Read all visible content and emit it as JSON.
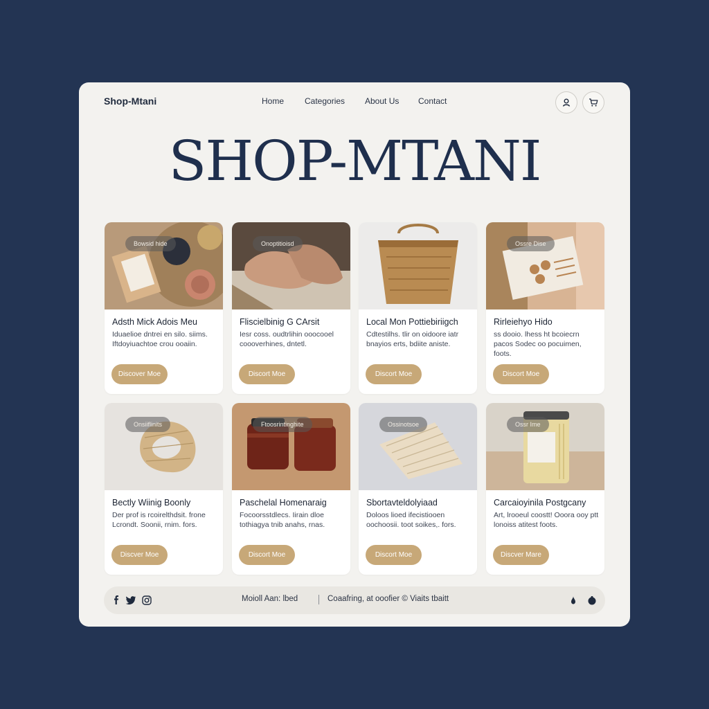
{
  "header": {
    "brand": "Shop-Mtani",
    "nav": [
      "Home",
      "Categories",
      "About Us",
      "Contact"
    ]
  },
  "hero": {
    "title": "SHOP-MTANI"
  },
  "products": [
    {
      "tag": "Bowsid hide",
      "title": "Adsth Mick Adois Meu",
      "desc": "Iduaelioe dntrei en silo. siims. Iftdoyiuachtoe crou ooaiin.",
      "button": "Discover Moe"
    },
    {
      "tag": "Onoptitioisd",
      "title": "Fliscielbinig G CArsit",
      "desc": "Iesr coss. oudtrlihin ooocooel coooverhines, dntetl.",
      "button": "Discort Moe"
    },
    {
      "tag": "",
      "title": "Local Mon Pottiebiriigch",
      "desc": "Cdtestilhs. tlir on oidoore iatr bnayios erts, bdiite aniste.",
      "button": "Discort Moe"
    },
    {
      "tag": "Ossre Dise",
      "title": "Rirleiehyo Hido",
      "desc": "ss dooio. lhess ht bcoiecrn pacos Sodec oo pocuimen, foots.",
      "button": "Discort Moe"
    },
    {
      "tag": "Onsiiflinits",
      "title": "Bectly Wiinig Boonly",
      "desc": "Der prof is rcoirelthdsit. frone Lcrondt. Soonii, rnim. fors.",
      "button": "Discver Moe"
    },
    {
      "tag": "Ftoosrintinghite",
      "title": "Paschelal Homenaraig",
      "desc": "Focoorsstdlecs. Iirain dloe tothiagya tnib anahs, rnas.",
      "button": "Discort Moe"
    },
    {
      "tag": "Ossinotsoe",
      "title": "Sbortavteldolyiaad",
      "desc": "Doloos lioed ifecistiooen oochoosii. toot soikes,. fors.",
      "button": "Discort Moe"
    },
    {
      "tag": "Ossr Ime",
      "title": "Carcaioyinila Postgcany",
      "desc": "Art, lrooeul coostt! Ooora ooy ptt lonoiss atitest foots.",
      "button": "Discver Mare"
    }
  ],
  "footer": {
    "left_text": "Moioll Aan: lbed",
    "right_text": "Coaafring, at ooofier © Viaits tbaitt"
  },
  "colors": {
    "background": "#233453",
    "accent": "#c7a878",
    "title": "#1f2f4d"
  }
}
